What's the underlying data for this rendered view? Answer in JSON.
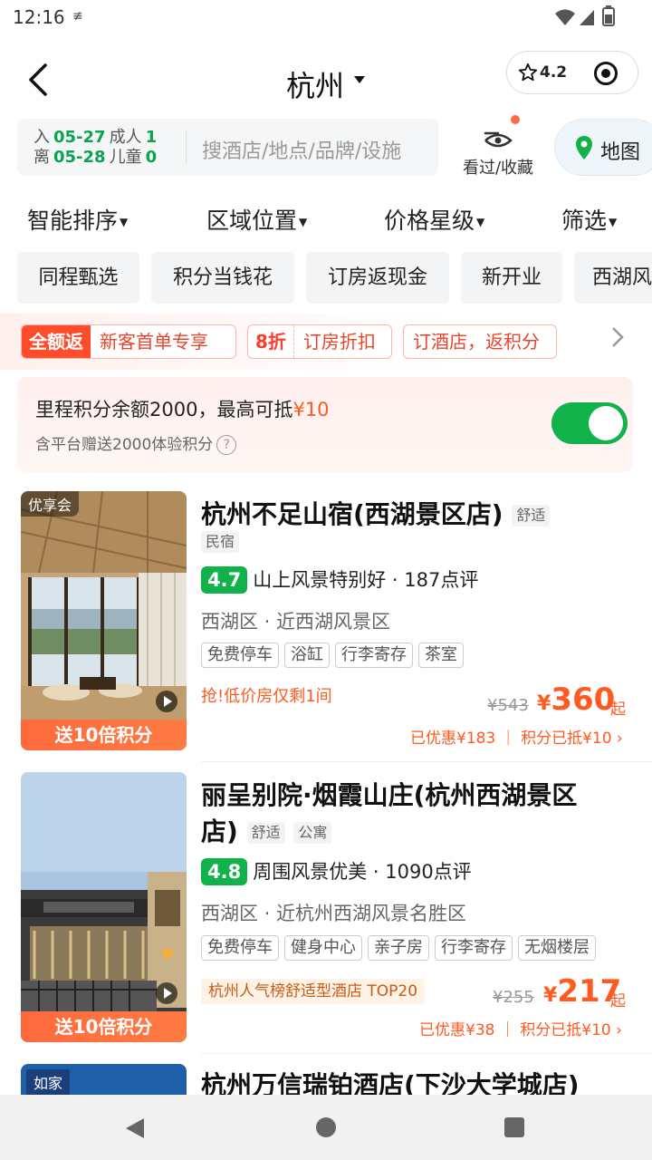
{
  "status": {
    "time": "12:16",
    "dnd": "≢"
  },
  "header": {
    "city": "杭州",
    "rating": "4.2"
  },
  "search": {
    "in_label": "入",
    "in_date": "05-27",
    "adult_label": "成人",
    "adult_count": "1",
    "out_label": "离",
    "out_date": "05-28",
    "child_label": "儿童",
    "child_count": "0",
    "placeholder": "搜酒店/地点/品牌/设施",
    "favorites_label": "看过/收藏",
    "map_label": "地图"
  },
  "sort": [
    "智能排序",
    "区域位置",
    "价格星级",
    "筛选"
  ],
  "tags": [
    "同程甄选",
    "积分当钱花",
    "订房返现金",
    "新开业",
    "西湖风"
  ],
  "promo": {
    "chip1_solid": "全额返",
    "chip1_text": "新客首单专享",
    "chip2_red": "8折",
    "chip2_text": "订房折扣",
    "chip3_text": "订酒店，返积分"
  },
  "points": {
    "main_prefix": "里程积分余额2000，最高可抵",
    "main_amount": "¥10",
    "sub": "含平台赠送2000体验积分",
    "qmark": "?",
    "toggle_on": true
  },
  "hotels": [
    {
      "badge": "优享会",
      "bonus": "送10倍积分",
      "name": "杭州不足山宿(西湖景区店)",
      "tags": [
        "舒适",
        "民宿"
      ],
      "score": "4.7",
      "comment": "山上风景特别好",
      "reviews": "· 187点评",
      "area": "西湖区 · 近西湖风景区",
      "facilities": [
        "免费停车",
        "浴缸",
        "行李寄存",
        "茶室"
      ],
      "alert": "抢!低价房仅剩1间",
      "orig_price": "¥543",
      "currency": "¥",
      "price": "360",
      "qi": "起",
      "discount": "已优惠¥183 ｜ 积分已抵¥10 ›"
    },
    {
      "badge": "",
      "bonus": "送10倍积分",
      "name_line1": "丽呈别院·烟霞山庄(杭州西湖景区",
      "name_line2": "店)",
      "tags": [
        "舒适",
        "公寓"
      ],
      "score": "4.8",
      "comment": "周围风景优美",
      "reviews": "· 1090点评",
      "area": "西湖区 · 近杭州西湖风景名胜区",
      "facilities": [
        "免费停车",
        "健身中心",
        "亲子房",
        "行李寄存",
        "无烟楼层"
      ],
      "rank": "杭州人气榜舒适型酒店 TOP20",
      "orig_price": "¥255",
      "currency": "¥",
      "price": "217",
      "qi": "起",
      "discount": "已优惠¥38 ｜ 积分已抵¥10 ›"
    },
    {
      "badge": "如家",
      "name": "杭州万信瑞铂酒店(下沙大学城店)"
    }
  ],
  "colors": {
    "accent_green": "#12b24b",
    "price_orange": "#ff5a1f",
    "promo_red": "#ff4d2b"
  },
  "icons": [
    "back-arrow-icon",
    "caret-down-icon",
    "star-icon",
    "target-icon",
    "eye-icon",
    "map-pin-icon",
    "chevron-right-icon",
    "play-icon",
    "back-nav-icon",
    "home-nav-icon",
    "recents-nav-icon"
  ]
}
